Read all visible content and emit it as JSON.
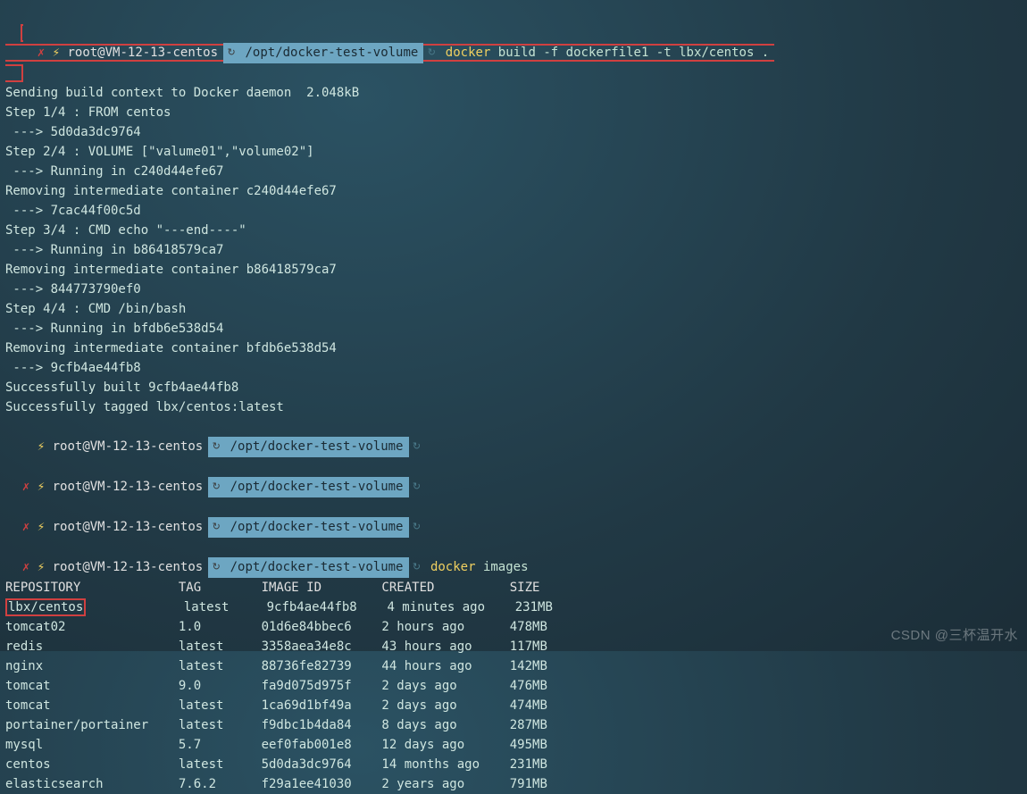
{
  "prompt": {
    "user_host": "root@VM-12-13-centos",
    "path": "/opt/docker-test-volume",
    "build_cmd_kw": "docker",
    "build_cmd_rest": " build -f dockerfile1 -t lbx/centos .",
    "images_cmd_kw": "docker",
    "images_cmd_rest": " images"
  },
  "build_output": [
    "Sending build context to Docker daemon  2.048kB",
    "Step 1/4 : FROM centos",
    " ---> 5d0da3dc9764",
    "Step 2/4 : VOLUME [\"valume01\",\"volume02\"]",
    " ---> Running in c240d44efe67",
    "Removing intermediate container c240d44efe67",
    " ---> 7cac44f00c5d",
    "Step 3/4 : CMD echo \"---end----\"",
    " ---> Running in b86418579ca7",
    "Removing intermediate container b86418579ca7",
    " ---> 844773790ef0",
    "Step 4/4 : CMD /bin/bash",
    " ---> Running in bfdb6e538d54",
    "Removing intermediate container bfdb6e538d54",
    " ---> 9cfb4ae44fb8",
    "Successfully built 9cfb4ae44fb8",
    "Successfully tagged lbx/centos:latest"
  ],
  "table": {
    "header": {
      "repo": "REPOSITORY",
      "tag": "TAG",
      "id": "IMAGE ID",
      "created": "CREATED",
      "size": "SIZE"
    },
    "rows": [
      {
        "repo": "lbx/centos",
        "tag": "latest",
        "id": "9cfb4ae44fb8",
        "created": "4 minutes ago",
        "size": "231MB",
        "hl": true
      },
      {
        "repo": "tomcat02",
        "tag": "1.0",
        "id": "01d6e84bbec6",
        "created": "2 hours ago",
        "size": "478MB"
      },
      {
        "repo": "redis",
        "tag": "latest",
        "id": "3358aea34e8c",
        "created": "43 hours ago",
        "size": "117MB"
      },
      {
        "repo": "nginx",
        "tag": "latest",
        "id": "88736fe82739",
        "created": "44 hours ago",
        "size": "142MB"
      },
      {
        "repo": "tomcat",
        "tag": "9.0",
        "id": "fa9d075d975f",
        "created": "2 days ago",
        "size": "476MB"
      },
      {
        "repo": "tomcat",
        "tag": "latest",
        "id": "1ca69d1bf49a",
        "created": "2 days ago",
        "size": "474MB"
      },
      {
        "repo": "portainer/portainer",
        "tag": "latest",
        "id": "f9dbc1b4da84",
        "created": "8 days ago",
        "size": "287MB"
      },
      {
        "repo": "mysql",
        "tag": "5.7",
        "id": "eef0fab001e8",
        "created": "12 days ago",
        "size": "495MB"
      },
      {
        "repo": "centos",
        "tag": "latest",
        "id": "5d0da3dc9764",
        "created": "14 months ago",
        "size": "231MB"
      },
      {
        "repo": "elasticsearch",
        "tag": "7.6.2",
        "id": "f29a1ee41030",
        "created": "2 years ago",
        "size": "791MB"
      }
    ]
  },
  "watermark": "CSDN @三杯温开水"
}
